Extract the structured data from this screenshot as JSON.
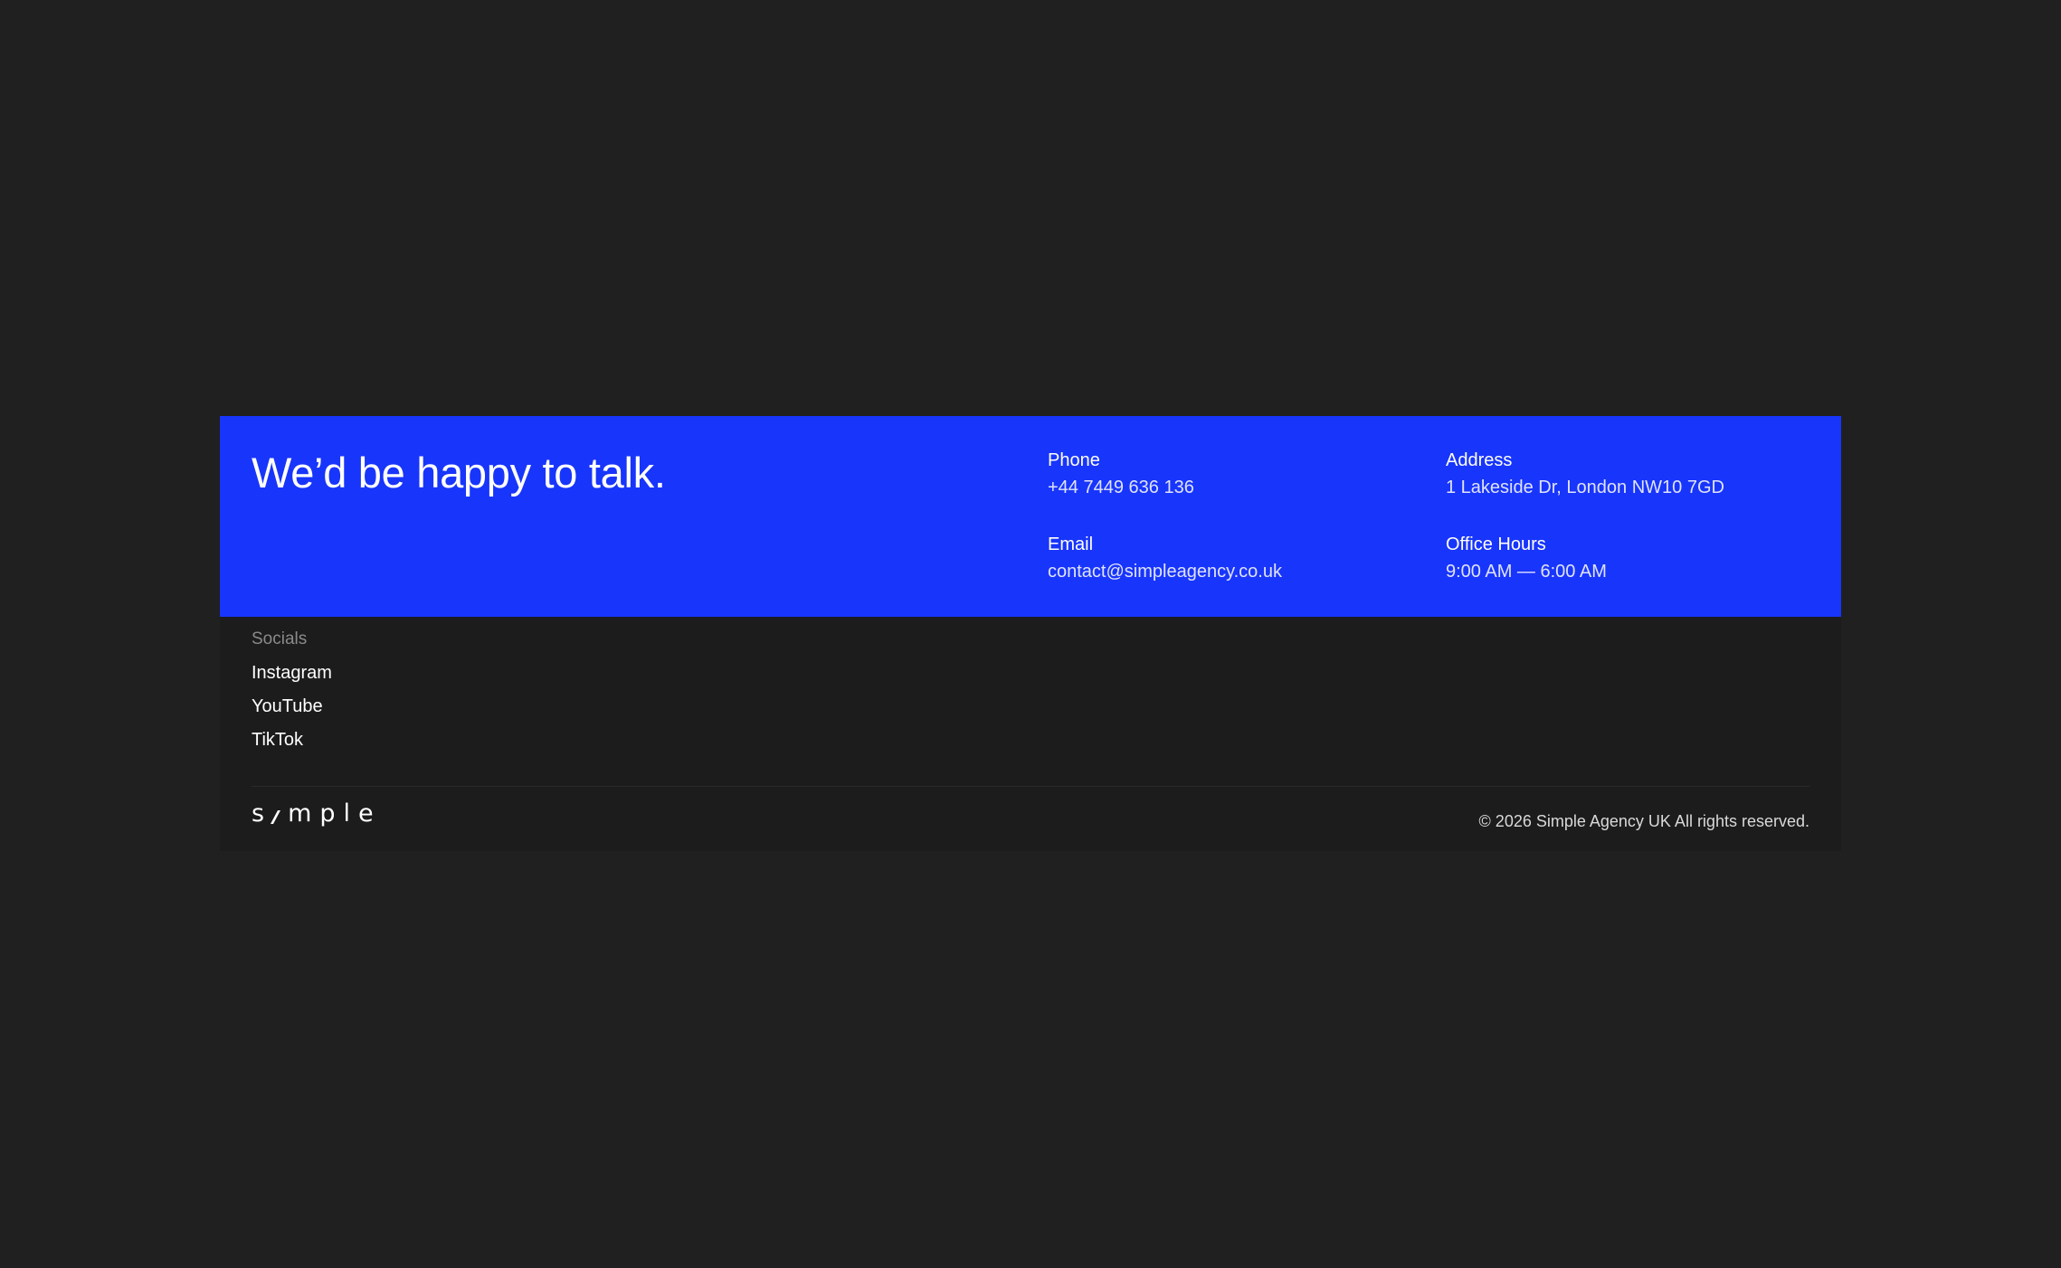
{
  "contact": {
    "headline": "We’d be happy to talk.",
    "phone": {
      "label": "Phone",
      "value": "+44 7449 636 136"
    },
    "address": {
      "label": "Address",
      "value": "1 Lakeside Dr, London NW10 7GD"
    },
    "email": {
      "label": "Email",
      "value": "contact@simpleagency.co.uk"
    },
    "hours": {
      "label": "Office Hours",
      "value": "9:00 AM — 6:00 AM"
    }
  },
  "socials": {
    "heading": "Socials",
    "links": [
      "Instagram",
      "YouTube",
      "TikTok"
    ]
  },
  "brand": {
    "logo_start": "s",
    "logo_end": "mple"
  },
  "copyright": "© 2026 Simple Agency UK All rights reserved.",
  "colors": {
    "page_bg": "#202020",
    "accent": "#1835fb",
    "footer_bg": "#1c1c1c"
  }
}
